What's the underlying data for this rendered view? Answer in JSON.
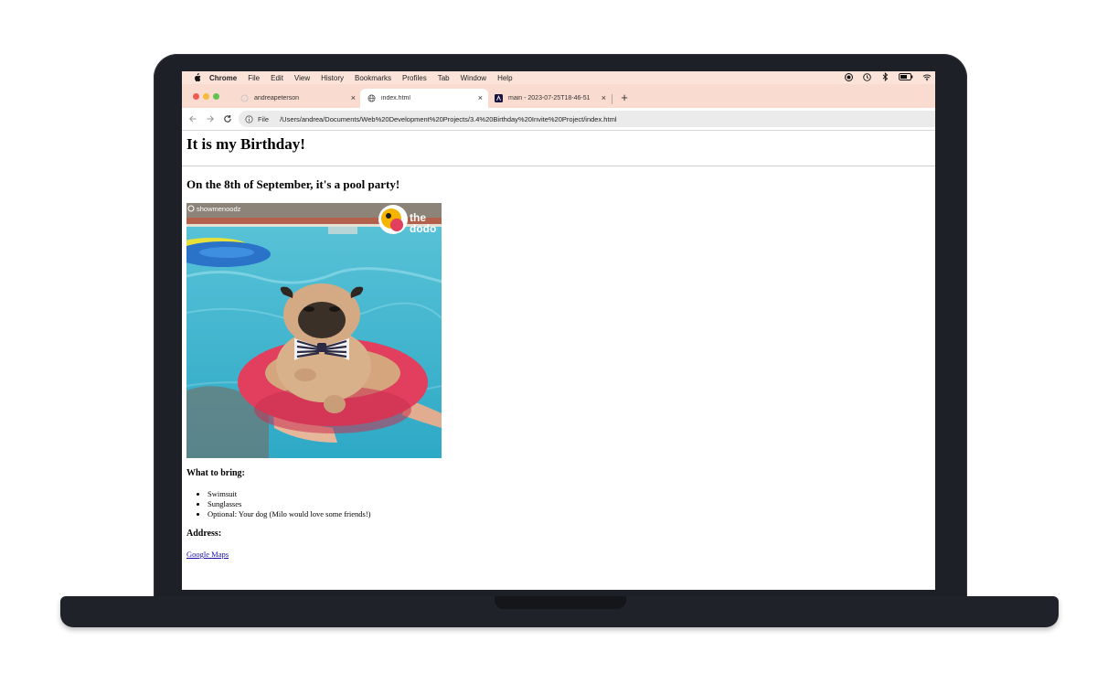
{
  "menubar": {
    "apple_icon": "apple-logo-icon",
    "items": [
      "Chrome",
      "File",
      "Edit",
      "View",
      "History",
      "Bookmarks",
      "Profiles",
      "Tab",
      "Window",
      "Help"
    ],
    "status_icons": [
      "screen-record-icon",
      "clock-icon",
      "bluetooth-icon",
      "battery-icon",
      "wifi-icon"
    ]
  },
  "tabs": [
    {
      "label": "andreapeterson",
      "active": false
    },
    {
      "label": "index.html",
      "active": true
    },
    {
      "label": "main - 2023-07-25T18-46-51",
      "active": false
    }
  ],
  "toolbar": {
    "scheme": "File",
    "url": "/Users/andrea/Documents/Web%20Development%20Projects/3.4%20Birthday%20Invite%20Project/index.html"
  },
  "page": {
    "title": "It is my Birthday!",
    "subtitle": "On the 8th of September, it's a pool party!",
    "image_watermark": "showmenoodz",
    "image_logo": "the dodo",
    "bring_heading": "What to bring:",
    "bring_items": [
      "Swimsuit",
      "Sunglasses",
      "Optional: Your dog (Milo would love some friends!)"
    ],
    "address_heading": "Address:",
    "map_link": "Google Maps"
  },
  "colors": {
    "chrome_tabstrip": "#fadbd0",
    "menubar": "#fbe3da",
    "link": "#1a0dab",
    "laptop": "#1d2026"
  }
}
